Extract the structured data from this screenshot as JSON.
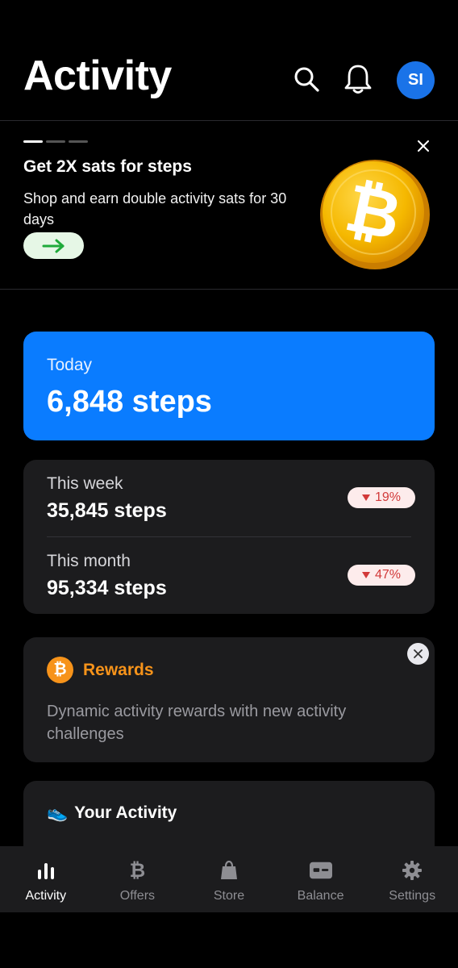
{
  "header": {
    "title": "Activity",
    "avatar_initials": "SI",
    "icons": [
      "search-icon",
      "bell-icon"
    ]
  },
  "promo": {
    "title": "Get 2X sats for steps",
    "text": "Shop and earn double activity sats for 30 days",
    "pages": 3,
    "active_page": 1,
    "button_icon": "arrow-right-icon"
  },
  "today": {
    "label": "Today",
    "value": "6,848 steps"
  },
  "stats": [
    {
      "label": "This week",
      "value": "35,845 steps",
      "change": "19%",
      "direction": "down"
    },
    {
      "label": "This month",
      "value": "95,334 steps",
      "change": "47%",
      "direction": "down"
    }
  ],
  "rewards": {
    "title": "Rewards",
    "text": "Dynamic activity rewards with new activity challenges"
  },
  "your_activity": {
    "title": "Your Activity",
    "emoji": "👟"
  },
  "nav": [
    {
      "label": "Activity",
      "icon": "bar-chart-icon",
      "active": true
    },
    {
      "label": "Offers",
      "icon": "bitcoin-icon",
      "active": false
    },
    {
      "label": "Store",
      "icon": "shopping-bag-icon",
      "active": false
    },
    {
      "label": "Balance",
      "icon": "wallet-card-icon",
      "active": false
    },
    {
      "label": "Settings",
      "icon": "gear-icon",
      "active": false
    }
  ],
  "colors": {
    "accent_blue": "#0a7cff",
    "bitcoin_orange": "#f7931a",
    "negative_red": "#d23a3a"
  }
}
